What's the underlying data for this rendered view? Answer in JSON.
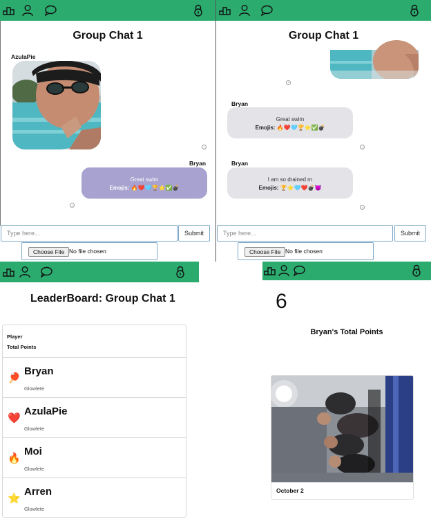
{
  "chat_left": {
    "title": "Group Chat 1",
    "messages": [
      {
        "sender": "AzulaPie",
        "type": "image"
      },
      {
        "sender": "Bryan",
        "text": "Great swim",
        "emoji_label": "Emojis:",
        "emojis": "🔥❤️🩵🏆⭐✅💣"
      }
    ],
    "input_placeholder": "Type here...",
    "submit_label": "Submit",
    "choose_file_label": "Choose File",
    "no_file_label": "No file chosen"
  },
  "chat_right": {
    "title": "Group Chat 1",
    "messages": [
      {
        "sender": "",
        "type": "image"
      },
      {
        "sender": "Bryan",
        "text": "Great swim",
        "emoji_label": "Emojis:",
        "emojis": "🔥❤️🩵🏆⭐✅💣"
      },
      {
        "sender": "Bryan",
        "text": "I am so drained rn",
        "emoji_label": "Emojis:",
        "emojis": "🏆⭐🩵❤️💣😈"
      }
    ],
    "input_placeholder": "Type here...",
    "submit_label": "Submit",
    "choose_file_label": "Choose File",
    "no_file_label": "No file chosen"
  },
  "leaderboard": {
    "title": "LeaderBoard: Group Chat 1",
    "header_player": "Player",
    "header_points": "Total Points",
    "rows": [
      {
        "name": "Bryan",
        "emoji": "🏓",
        "subtitle": "Glowlete"
      },
      {
        "name": "AzulaPie",
        "emoji": "❤️",
        "subtitle": "Glowlete"
      },
      {
        "name": "Moi",
        "emoji": "🔥",
        "subtitle": "Glowlete"
      },
      {
        "name": "Arren",
        "emoji": "⭐",
        "subtitle": "Glowlete"
      }
    ]
  },
  "profile": {
    "points": "6",
    "points_label": "Bryan's Total Points",
    "photo_caption": "October 2"
  },
  "nav_icons": [
    "leaderboard-icon",
    "profile-icon",
    "chat-icon",
    "lock-icon"
  ],
  "colors": {
    "topbar": "#2bab6e",
    "sent_bubble": "#a7a2cf",
    "received_bubble": "#e4e4e8"
  }
}
